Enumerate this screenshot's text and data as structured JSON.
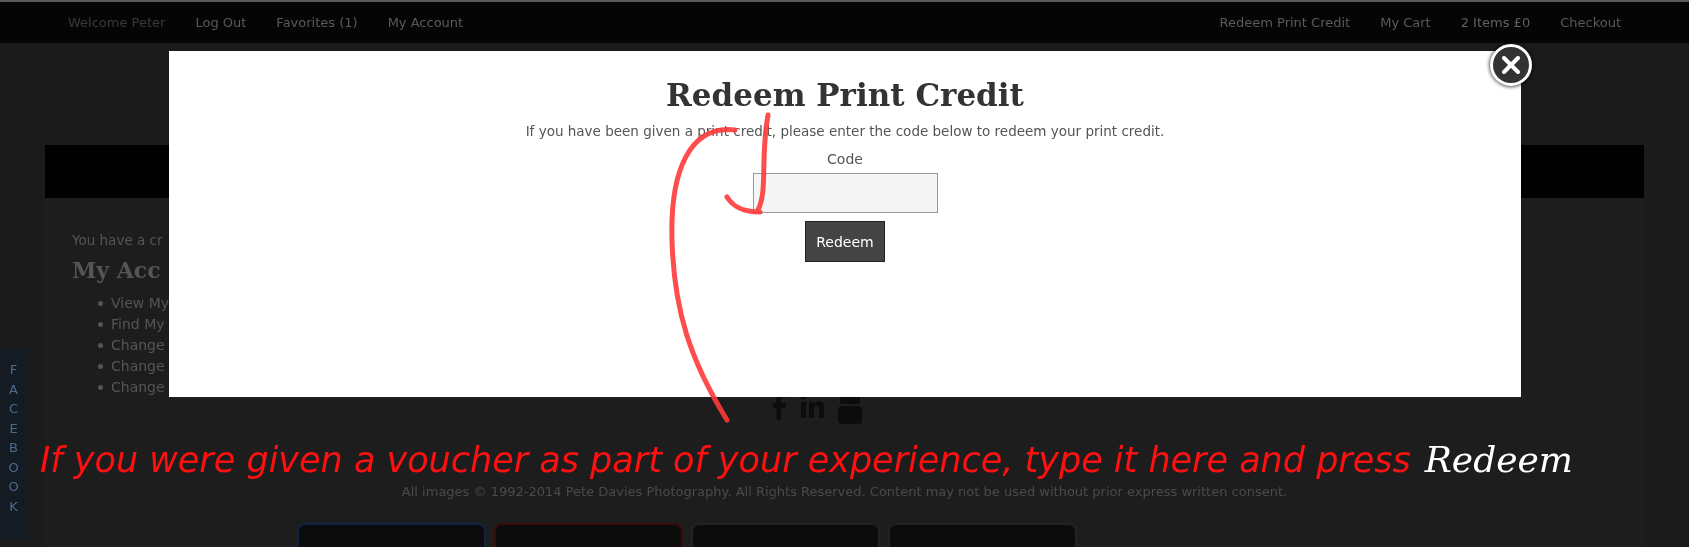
{
  "top_nav": {
    "left": [
      {
        "label": "Welcome Peter",
        "kind": "greeting"
      },
      {
        "label": "Log Out",
        "kind": "link"
      },
      {
        "label": "Favorites (1)",
        "kind": "link"
      },
      {
        "label": "My Account",
        "kind": "link"
      }
    ],
    "right": [
      {
        "label": "Redeem Print Credit",
        "kind": "link"
      },
      {
        "label": "My Cart",
        "kind": "link"
      },
      {
        "label": "2 Items £0",
        "kind": "count"
      },
      {
        "label": "Checkout",
        "kind": "link"
      }
    ]
  },
  "side_tab": {
    "label": "FACEBOOK"
  },
  "page": {
    "notice": "You have a cr",
    "heading": "My Acc",
    "links": [
      "View My",
      "Find My",
      "Change",
      "Change",
      "Change"
    ]
  },
  "footer": {
    "copyright": "All images © 1992-2014 Pete Davies Photography. All Rights Reserved. Content may not be used without prior express written consent."
  },
  "modal": {
    "title": "Redeem Print Credit",
    "intro": "If you have been given a print credit, please enter the code below to redeem your print credit.",
    "field_label": "Code",
    "button": "Redeem"
  },
  "annotation": {
    "text": "If you were given a voucher as part of your experience, type it here and press",
    "highlight": "Redeem"
  }
}
